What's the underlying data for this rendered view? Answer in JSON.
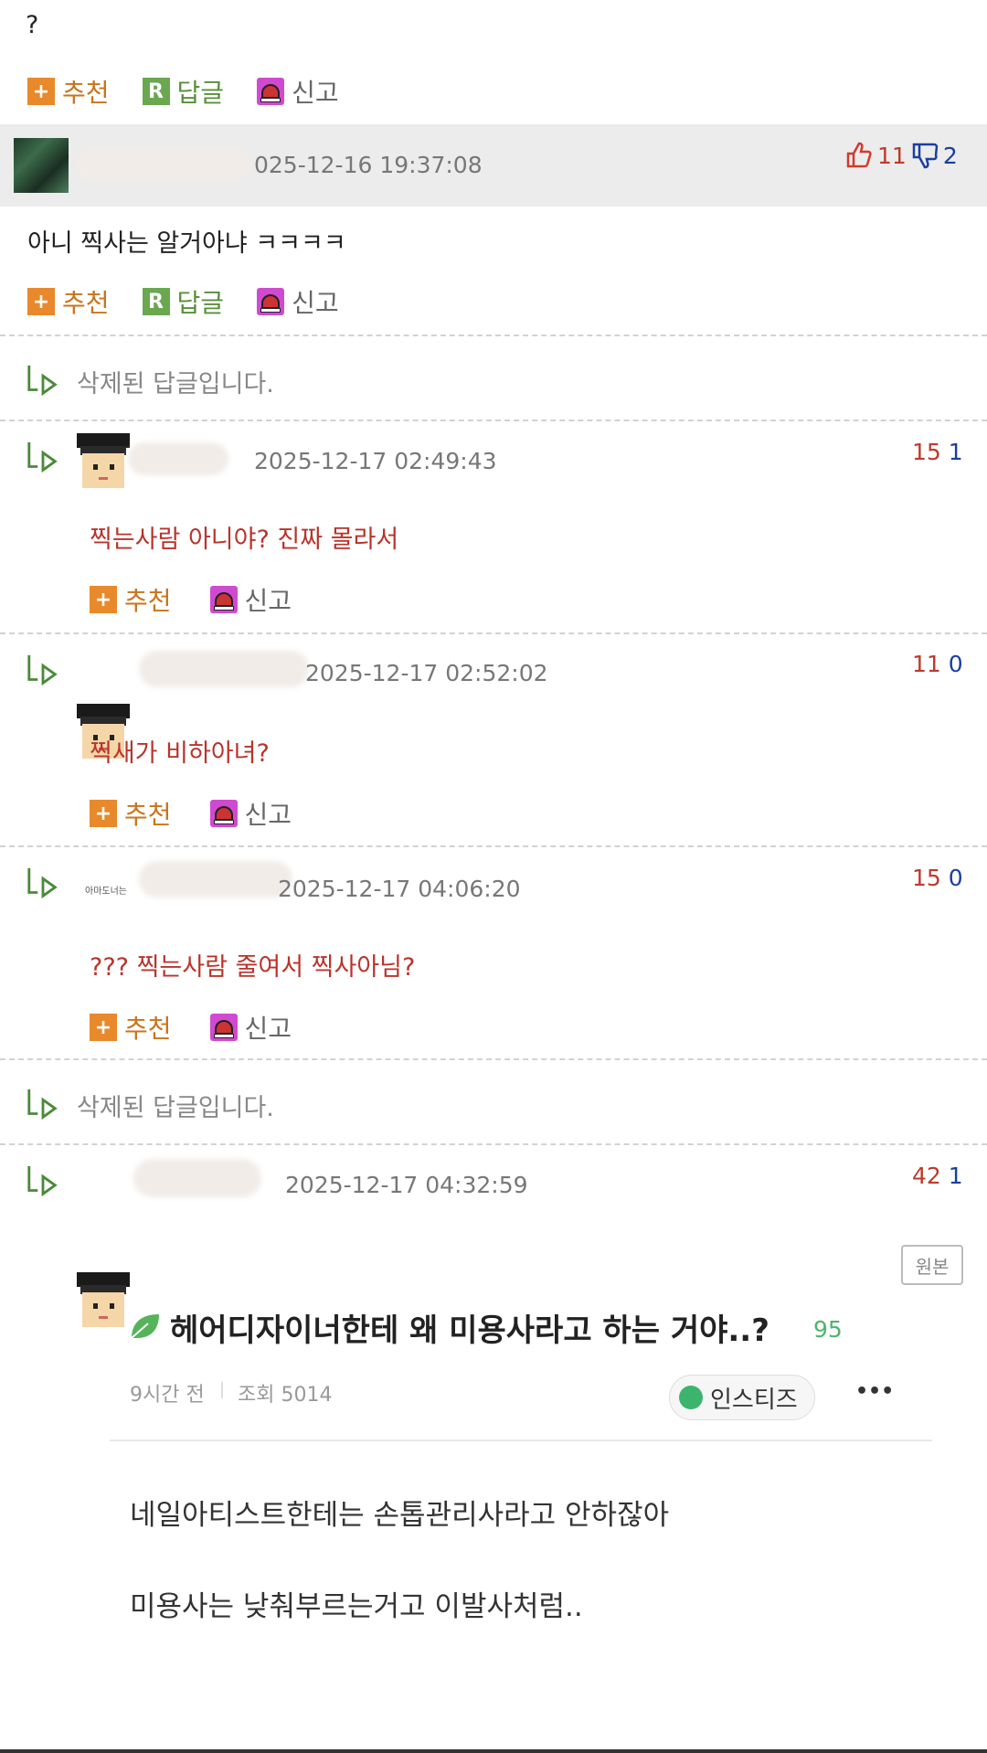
{
  "top_comment_text": "?",
  "actions": {
    "recommend": "추천",
    "reply": "답글",
    "report": "신고"
  },
  "comment": {
    "date": "025-12-16 19:37:08",
    "up": "11",
    "down": "2",
    "text": "아니 찍사는 알거아냐 ㅋㅋㅋㅋ"
  },
  "replies": [
    {
      "deleted_text": "삭제된 답글입니다."
    },
    {
      "date": "2025-12-17 02:49:43",
      "up": "15",
      "down": "1",
      "text": "찍는사람 아니야? 진짜 몰라서"
    },
    {
      "date": "2025-12-17 02:52:02",
      "up": "11",
      "down": "0",
      "text": "찍새가 비하아녀?"
    },
    {
      "date": "2025-12-17 04:06:20",
      "up": "15",
      "down": "0",
      "text": "??? 찍는사람 줄여서 찍사아님?",
      "avatar_text": "아마도너는"
    },
    {
      "deleted_text": "삭제된 답글입니다."
    },
    {
      "date": "2025-12-17 04:32:59",
      "up": "42",
      "down": "1"
    }
  ],
  "embed": {
    "origin_label": "원본",
    "title": "헤어디자이너한테 왜 미용사라고 하는 거야..?",
    "count": "95",
    "time": "9시간 전",
    "views": "조회 5014",
    "chip_label": "인스티즈",
    "more": "•••",
    "line1": "네일아티스트한테는 손톱관리사라고 안하잖아",
    "line2": "미용사는 낮춰부르는거고 이발사처럼.."
  }
}
